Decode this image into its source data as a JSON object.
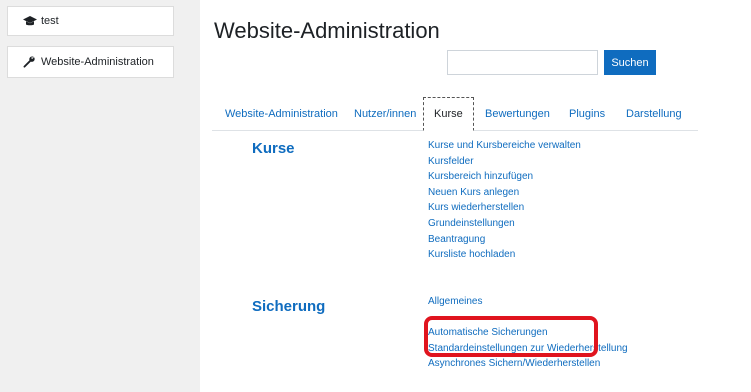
{
  "sidebar": {
    "items": [
      {
        "label": "test",
        "icon": "graduation-cap-icon"
      },
      {
        "label": "Website-Administration",
        "icon": "wrench-icon"
      }
    ]
  },
  "main": {
    "title": "Website-Administration",
    "search": {
      "placeholder": "",
      "value": "",
      "button_label": "Suchen"
    }
  },
  "tabs": [
    {
      "label": "Website-Administration",
      "active": false
    },
    {
      "label": "Nutzer/innen",
      "active": false
    },
    {
      "label": "Kurse",
      "active": true
    },
    {
      "label": "Bewertungen",
      "active": false
    },
    {
      "label": "Plugins",
      "active": false
    },
    {
      "label": "Darstellung",
      "active": false
    }
  ],
  "sections": [
    {
      "title": "Kurse",
      "links": [
        "Kurse und Kursbereiche verwalten",
        "Kursfelder",
        "Kursbereich hinzufügen",
        "Neuen Kurs anlegen",
        "Kurs wiederherstellen",
        "Grundeinstellungen",
        "Beantragung",
        "Kursliste hochladen"
      ]
    },
    {
      "title": "Sicherung",
      "links": [
        "Allgemeines",
        "Automatische Sicherungen",
        "Standardeinstellungen zur Wiederherstellung",
        "Asynchrones Sichern/Wiederherstellen"
      ]
    }
  ],
  "colors": {
    "link": "#0f6cbf",
    "highlight": "#e0141e",
    "sidebar_bg": "#f0f0f0"
  }
}
